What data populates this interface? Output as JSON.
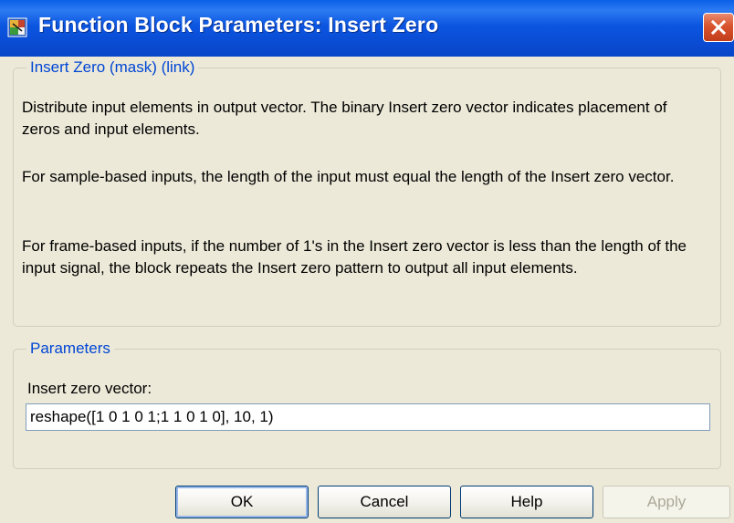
{
  "window": {
    "title": "Function Block Parameters: Insert Zero",
    "icon": "simulink-block-icon",
    "close_icon": "close-icon"
  },
  "description_group": {
    "legend": "Insert Zero (mask) (link)",
    "paragraphs": [
      "Distribute input elements in output vector. The binary Insert zero vector indicates placement of zeros and input elements.",
      "For sample-based inputs, the length of the input must equal the length of the Insert zero vector.",
      "For frame-based inputs, if the number of 1's in the Insert zero vector is less than the length of the input signal, the block repeats the Insert zero pattern to output all input elements."
    ]
  },
  "parameters_group": {
    "legend": "Parameters",
    "insert_zero_vector": {
      "label": "Insert zero vector:",
      "value": "reshape([1 0 1 0 1;1 1 0 1 0], 10, 1)"
    }
  },
  "buttons": {
    "ok": "OK",
    "cancel": "Cancel",
    "help": "Help",
    "apply": "Apply"
  },
  "colors": {
    "title_bar": "#0A4CD4",
    "group_legend": "#0046D5",
    "dialog_background": "#ECE9D8",
    "close_button": "#D9532E"
  }
}
